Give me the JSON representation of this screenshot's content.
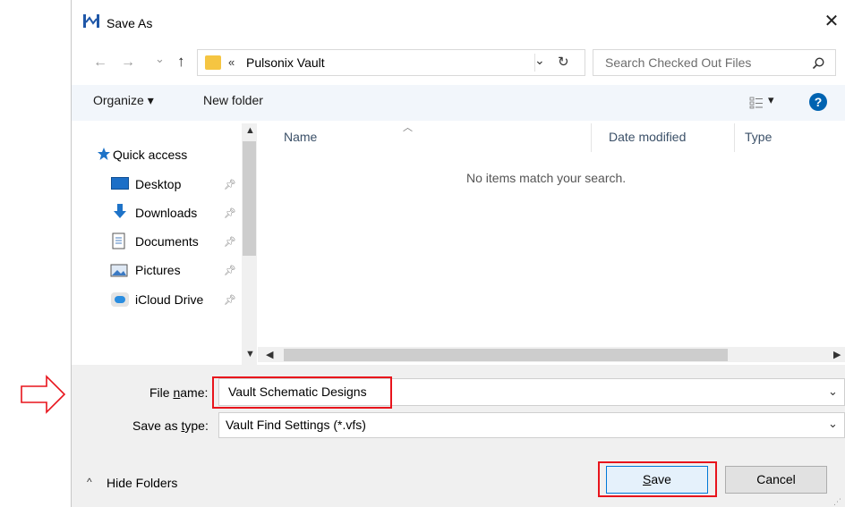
{
  "dialog": {
    "title": "Save As"
  },
  "nav": {
    "back_icon": "←",
    "forward_icon": "→",
    "recent_icon": "⌄",
    "up_icon": "↑",
    "refresh_icon": "↻",
    "dropdown_icon": "⌄"
  },
  "address": {
    "prefix": "«",
    "location": "Pulsonix Vault"
  },
  "search": {
    "placeholder": "Search Checked Out Files",
    "value": ""
  },
  "toolbar": {
    "organize_label": "Organize ▾",
    "new_folder_label": "New folder",
    "view_label": "▾",
    "help_label": "?"
  },
  "sidebar": {
    "quick_access_label": "Quick access",
    "items": [
      {
        "label": "Desktop",
        "icon": "desktop-icon"
      },
      {
        "label": "Downloads",
        "icon": "downloads-icon"
      },
      {
        "label": "Documents",
        "icon": "documents-icon"
      },
      {
        "label": "Pictures",
        "icon": "pictures-icon"
      },
      {
        "label": "iCloud Drive",
        "icon": "icloud-icon"
      }
    ]
  },
  "list": {
    "columns": [
      "Name",
      "Date modified",
      "Type"
    ],
    "empty_message": "No items match your search."
  },
  "form": {
    "file_name_label_pre": "File ",
    "file_name_label_u": "n",
    "file_name_label_post": "ame:",
    "file_name_value": "Vault Schematic Designs",
    "save_type_label_pre": "Save as ",
    "save_type_label_u": "t",
    "save_type_label_post": "ype:",
    "save_type_value": "Vault Find Settings (*.vfs)"
  },
  "footer": {
    "hide_folders_label": "Hide Folders",
    "save_label_u": "S",
    "save_label_post": "ave",
    "cancel_label": "Cancel"
  },
  "colors": {
    "highlight": "#e8141c",
    "accent": "#0078d7",
    "quick_access_star": "#1e73c8"
  }
}
